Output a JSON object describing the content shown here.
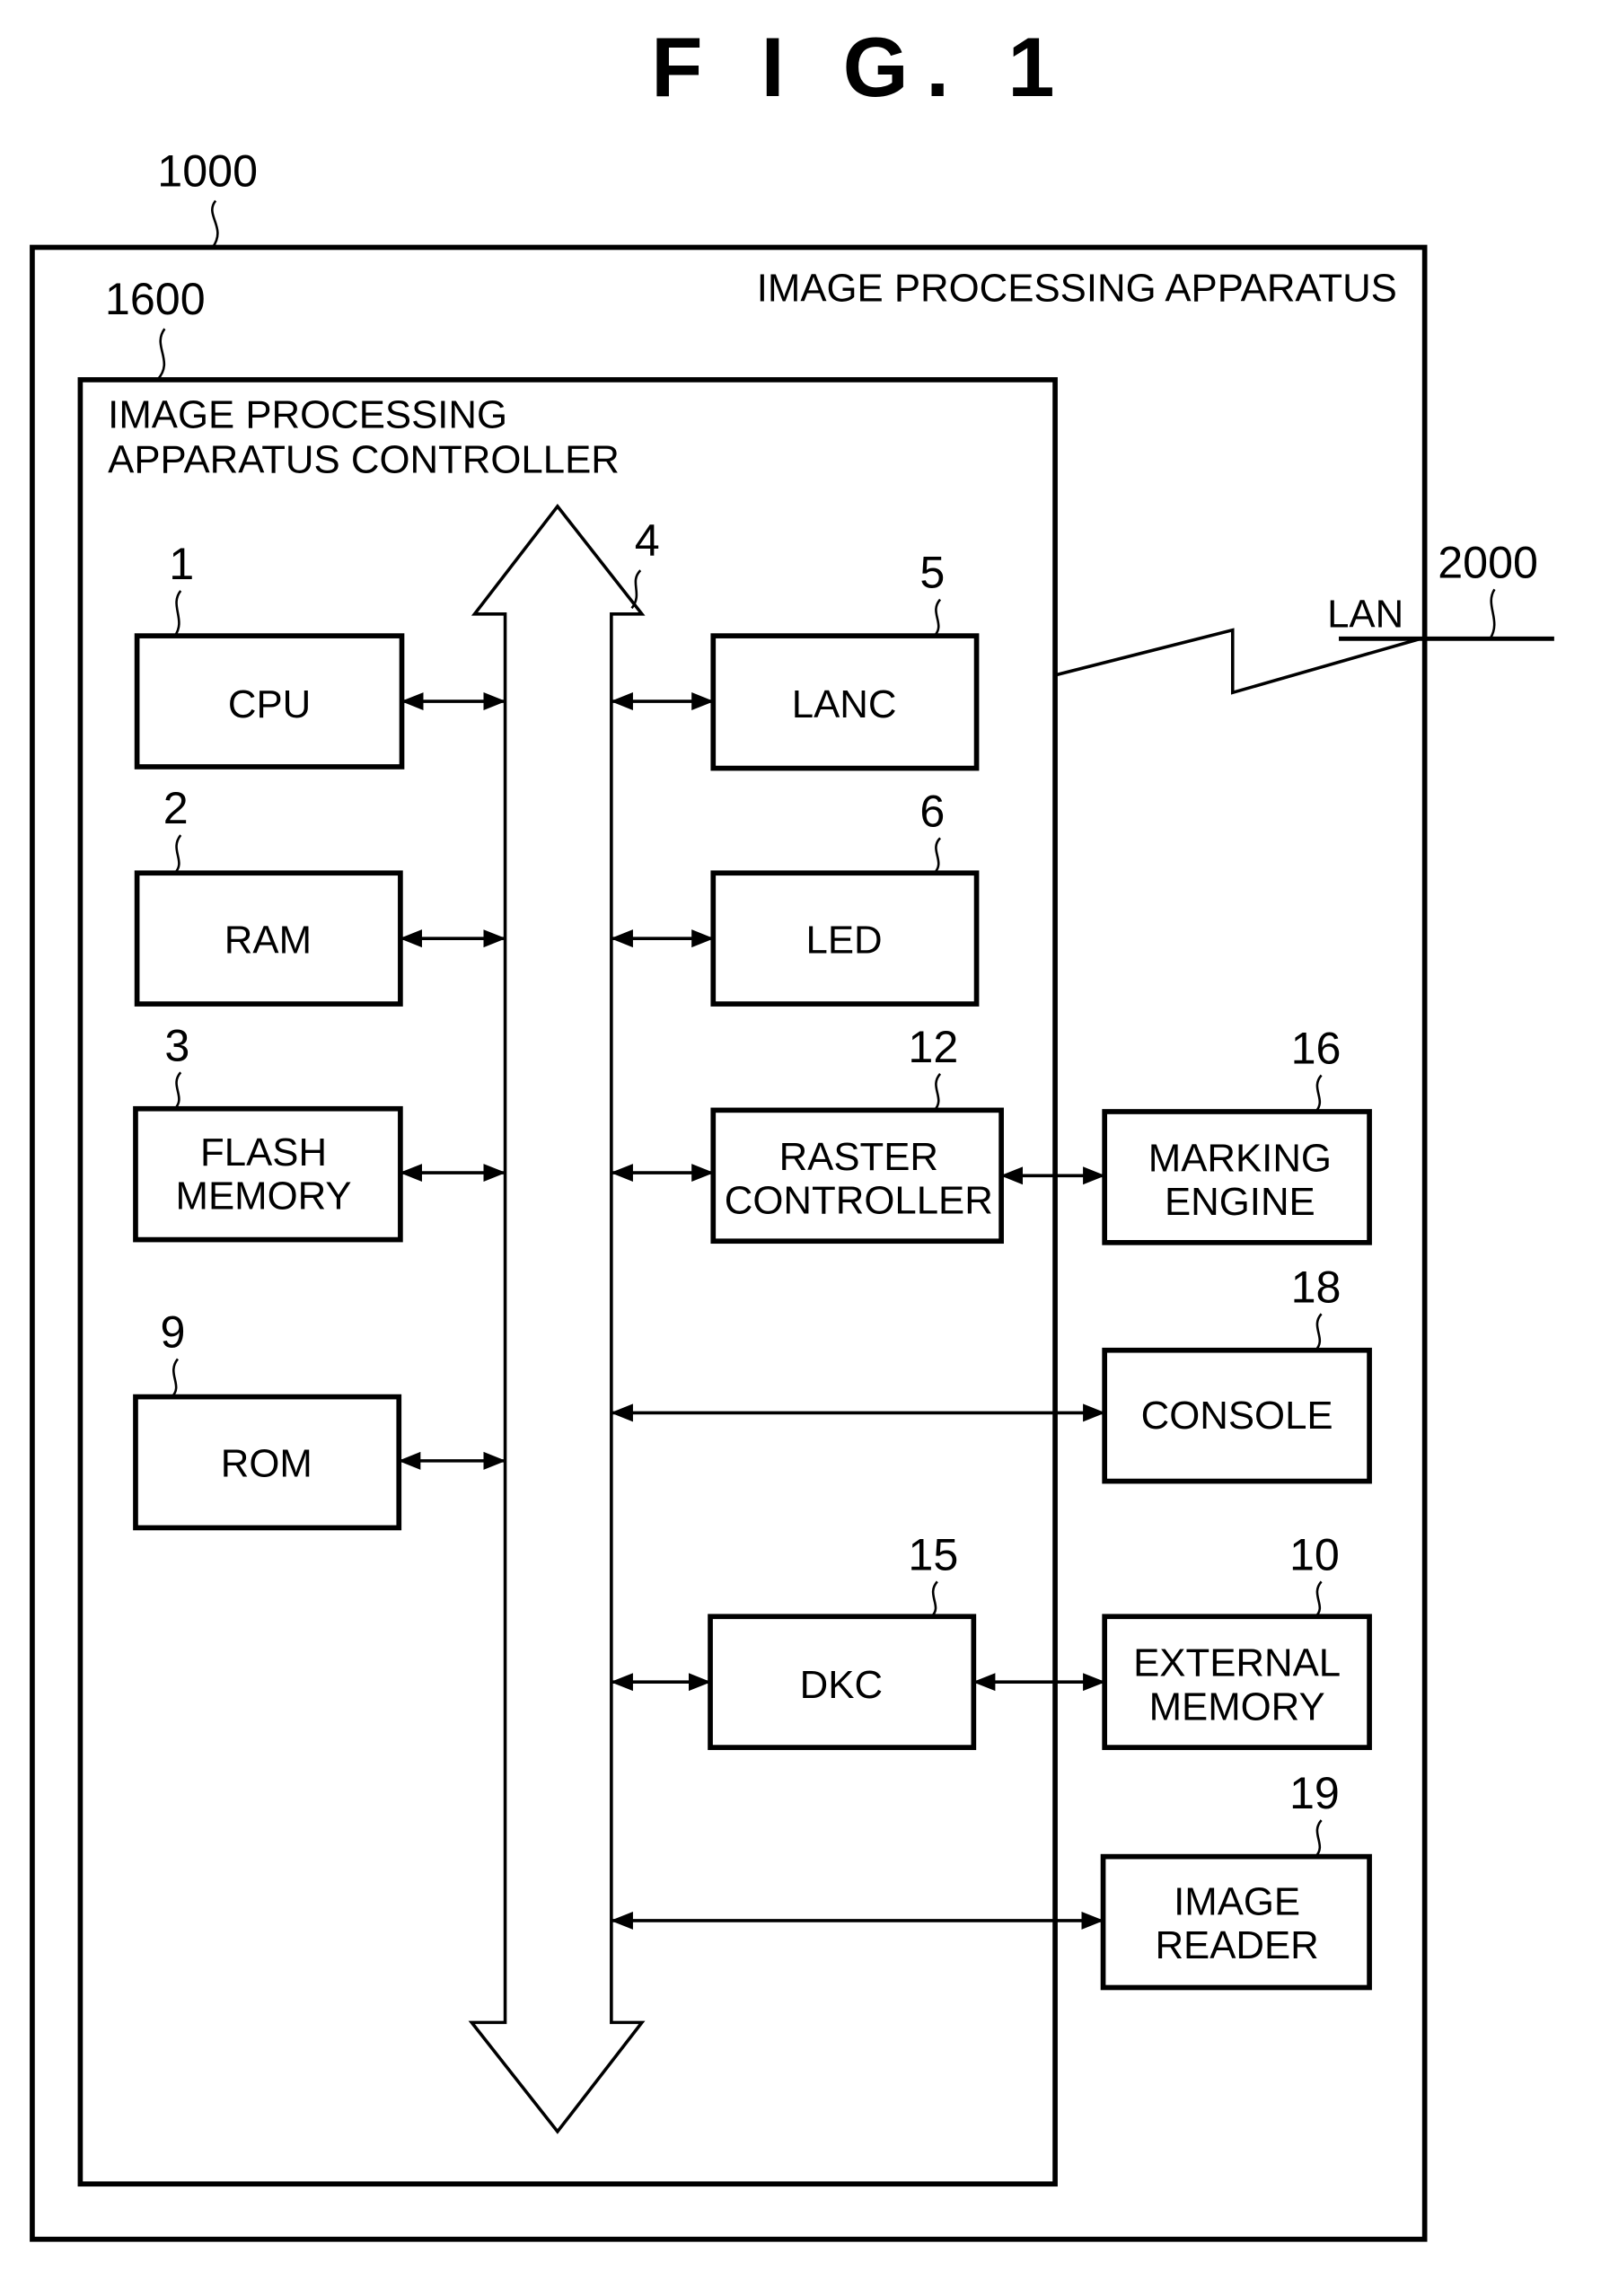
{
  "figure_title": "F I G.  1",
  "apparatus": {
    "ref": "1000",
    "label": "IMAGE PROCESSING APPARATUS"
  },
  "controller": {
    "ref": "1600",
    "label_line1": "IMAGE PROCESSING",
    "label_line2": "APPARATUS CONTROLLER"
  },
  "bus": {
    "ref": "4"
  },
  "network": {
    "ref": "2000",
    "label": "LAN"
  },
  "blocks": {
    "cpu": {
      "ref": "1",
      "lines": [
        "CPU"
      ]
    },
    "ram": {
      "ref": "2",
      "lines": [
        "RAM"
      ]
    },
    "flash": {
      "ref": "3",
      "lines": [
        "FLASH",
        "MEMORY"
      ]
    },
    "rom": {
      "ref": "9",
      "lines": [
        "ROM"
      ]
    },
    "lanc": {
      "ref": "5",
      "lines": [
        "LANC"
      ]
    },
    "led": {
      "ref": "6",
      "lines": [
        "LED"
      ]
    },
    "raster": {
      "ref": "12",
      "lines": [
        "RASTER",
        "CONTROLLER"
      ]
    },
    "dkc": {
      "ref": "15",
      "lines": [
        "DKC"
      ]
    },
    "marking": {
      "ref": "16",
      "lines": [
        "MARKING",
        "ENGINE"
      ]
    },
    "console": {
      "ref": "18",
      "lines": [
        "CONSOLE"
      ]
    },
    "extmem": {
      "ref": "10",
      "lines": [
        "EXTERNAL",
        "MEMORY"
      ]
    },
    "reader": {
      "ref": "19",
      "lines": [
        "IMAGE",
        "READER"
      ]
    }
  }
}
